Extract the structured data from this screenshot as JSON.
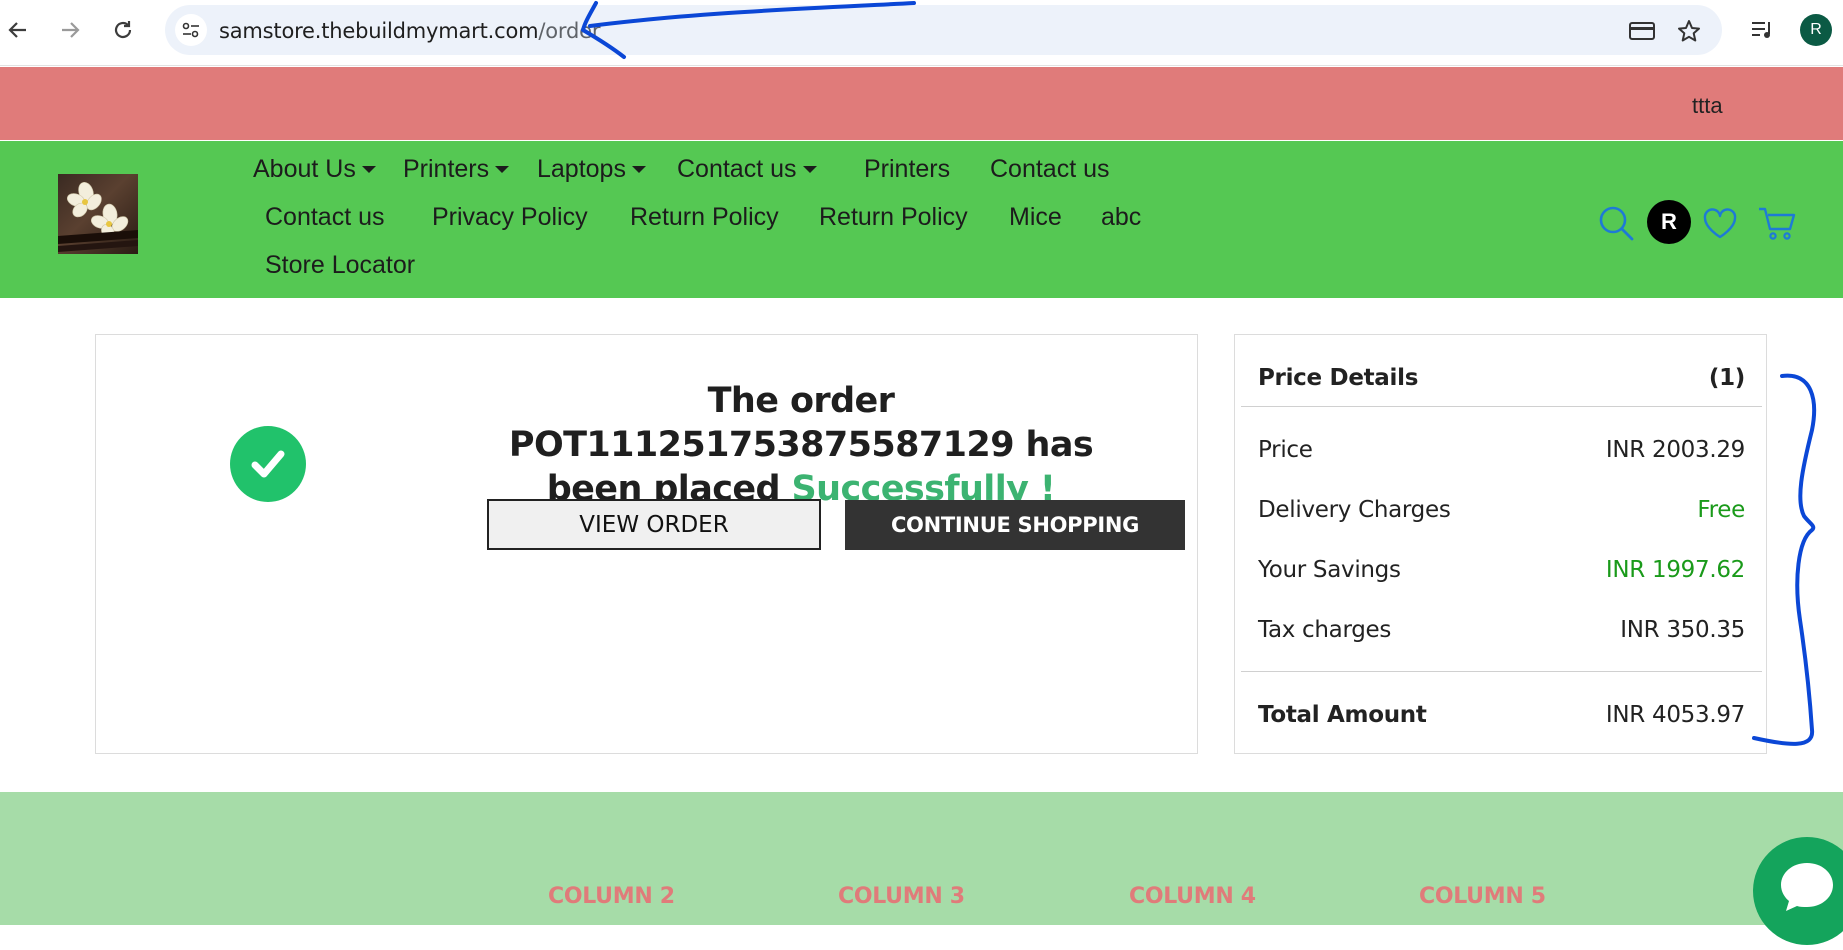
{
  "browser": {
    "url_host": "samstore.thebuildmymart.com",
    "url_path": "/order",
    "profile_initial": "R",
    "icons": [
      "back-arrow-icon",
      "forward-arrow-icon",
      "reload-icon",
      "site-settings-icon",
      "card-icon",
      "star-icon",
      "media-queue-icon"
    ]
  },
  "topbar": {
    "text": "ttta"
  },
  "header": {
    "menu": [
      {
        "label": "About Us",
        "dropdown": true
      },
      {
        "label": "Printers",
        "dropdown": true
      },
      {
        "label": "Laptops",
        "dropdown": true
      },
      {
        "label": "Contact us",
        "dropdown": true
      },
      {
        "label": "Printers",
        "dropdown": false
      },
      {
        "label": "Contact us",
        "dropdown": false
      },
      {
        "label": "Contact us",
        "dropdown": false
      },
      {
        "label": "Privacy Policy",
        "dropdown": false
      },
      {
        "label": "Return Policy",
        "dropdown": false
      },
      {
        "label": "Return Policy",
        "dropdown": false
      },
      {
        "label": "Mice",
        "dropdown": false
      },
      {
        "label": "abc",
        "dropdown": false
      },
      {
        "label": "Store Locator",
        "dropdown": false
      }
    ],
    "user_initial": "R",
    "icons": [
      "search-icon",
      "heart-icon",
      "cart-icon"
    ]
  },
  "order": {
    "message_prefix": "The order POT111251753875587129 has been placed ",
    "message_success": "Successfully !",
    "view_order_label": "VIEW ORDER",
    "continue_label": "CONTINUE SHOPPING"
  },
  "price_details": {
    "title": "Price Details",
    "count": "(1)",
    "rows": [
      {
        "label": "Price",
        "value": "INR 2003.29"
      },
      {
        "label": "Delivery Charges",
        "value": "Free"
      },
      {
        "label": "Your Savings",
        "value": "INR 1997.62"
      },
      {
        "label": "Tax charges",
        "value": "INR 350.35"
      }
    ],
    "total_label": "Total Amount",
    "total_value": "INR 4053.97"
  },
  "footer": {
    "columns": [
      "COLUMN 2",
      "COLUMN 3",
      "COLUMN 4",
      "COLUMN 5"
    ]
  },
  "colors": {
    "topbar": "#e07b7a",
    "header": "#55c853",
    "footer": "#a6dca8",
    "success": "#3cb371",
    "annotation": "#0b47d6"
  }
}
